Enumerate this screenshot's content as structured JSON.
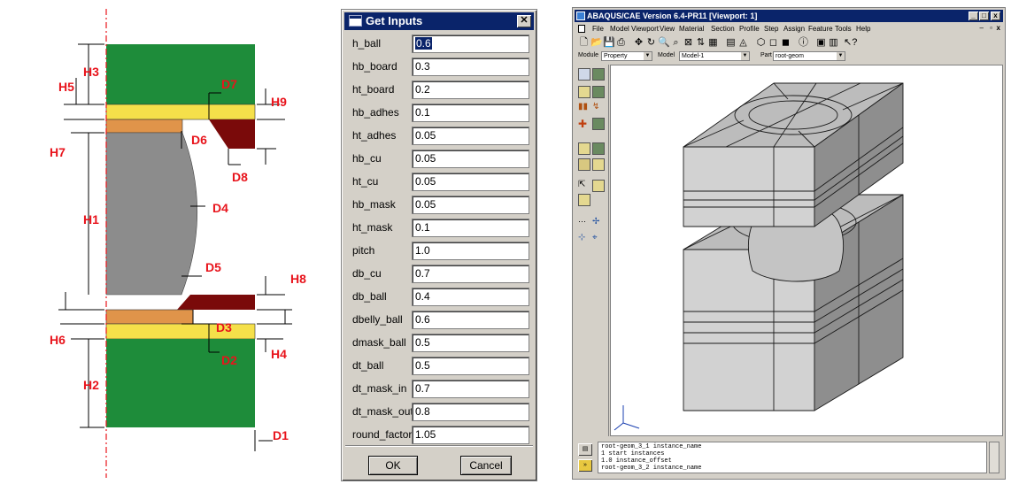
{
  "diagram": {
    "labels": {
      "h1": "H1",
      "h2": "H2",
      "h3": "H3",
      "h4": "H4",
      "h5": "H5",
      "h6": "H6",
      "h7": "H7",
      "h8": "H8",
      "h9": "H9",
      "d1": "D1",
      "d2": "D2",
      "d3": "D3",
      "d4": "D4",
      "d5": "D5",
      "d6": "D6",
      "d7": "D7",
      "d8": "D8"
    },
    "colors": {
      "board": "#1e8c3a",
      "adhesive": "#f5e04a",
      "copper": "#e0944a",
      "mask": "#7a0a0a",
      "ball": "#8c8c8c",
      "annotation": "#e8141c"
    }
  },
  "dialog": {
    "title": "Get Inputs",
    "fields": [
      {
        "label": "h_ball",
        "value": "0.6"
      },
      {
        "label": "hb_board",
        "value": "0.3"
      },
      {
        "label": "ht_board",
        "value": "0.2"
      },
      {
        "label": "hb_adhes",
        "value": "0.1"
      },
      {
        "label": "ht_adhes",
        "value": "0.05"
      },
      {
        "label": "hb_cu",
        "value": "0.05"
      },
      {
        "label": "ht_cu",
        "value": "0.05"
      },
      {
        "label": "hb_mask",
        "value": "0.05"
      },
      {
        "label": "ht_mask",
        "value": "0.1"
      },
      {
        "label": "pitch",
        "value": "1.0"
      },
      {
        "label": "db_cu",
        "value": "0.7"
      },
      {
        "label": "db_ball",
        "value": "0.4"
      },
      {
        "label": "dbelly_ball",
        "value": "0.6"
      },
      {
        "label": "dmask_ball",
        "value": "0.5"
      },
      {
        "label": "dt_ball",
        "value": "0.5"
      },
      {
        "label": "dt_mask_in",
        "value": "0.7"
      },
      {
        "label": "dt_mask_out",
        "value": "0.8"
      },
      {
        "label": "round_factor",
        "value": "1.05"
      }
    ],
    "ok_label": "OK",
    "cancel_label": "Cancel"
  },
  "abaqus": {
    "title": "ABAQUS/CAE Version 6.4-PR11 [Viewport: 1]",
    "menu": [
      "File",
      "Model",
      "Viewport",
      "View",
      "Material",
      "Section",
      "Profile",
      "Step",
      "Assign",
      "Feature",
      "Tools",
      "Help"
    ],
    "module_label": "Module",
    "module_value": "Property",
    "model_label": "Model",
    "model_value": "Model-1",
    "part_label": "Part",
    "part_value": "root-geom",
    "messages": [
      "root-geom_3_1 instance_name",
      "1 start instances",
      "1.0 instance_offset",
      "root-geom_3_2 instance_name"
    ],
    "colors": {
      "title": "#0a246a",
      "face_top": "#bcbcbc",
      "face_left": "#d2d2d2",
      "face_right": "#8e8e8e"
    }
  }
}
